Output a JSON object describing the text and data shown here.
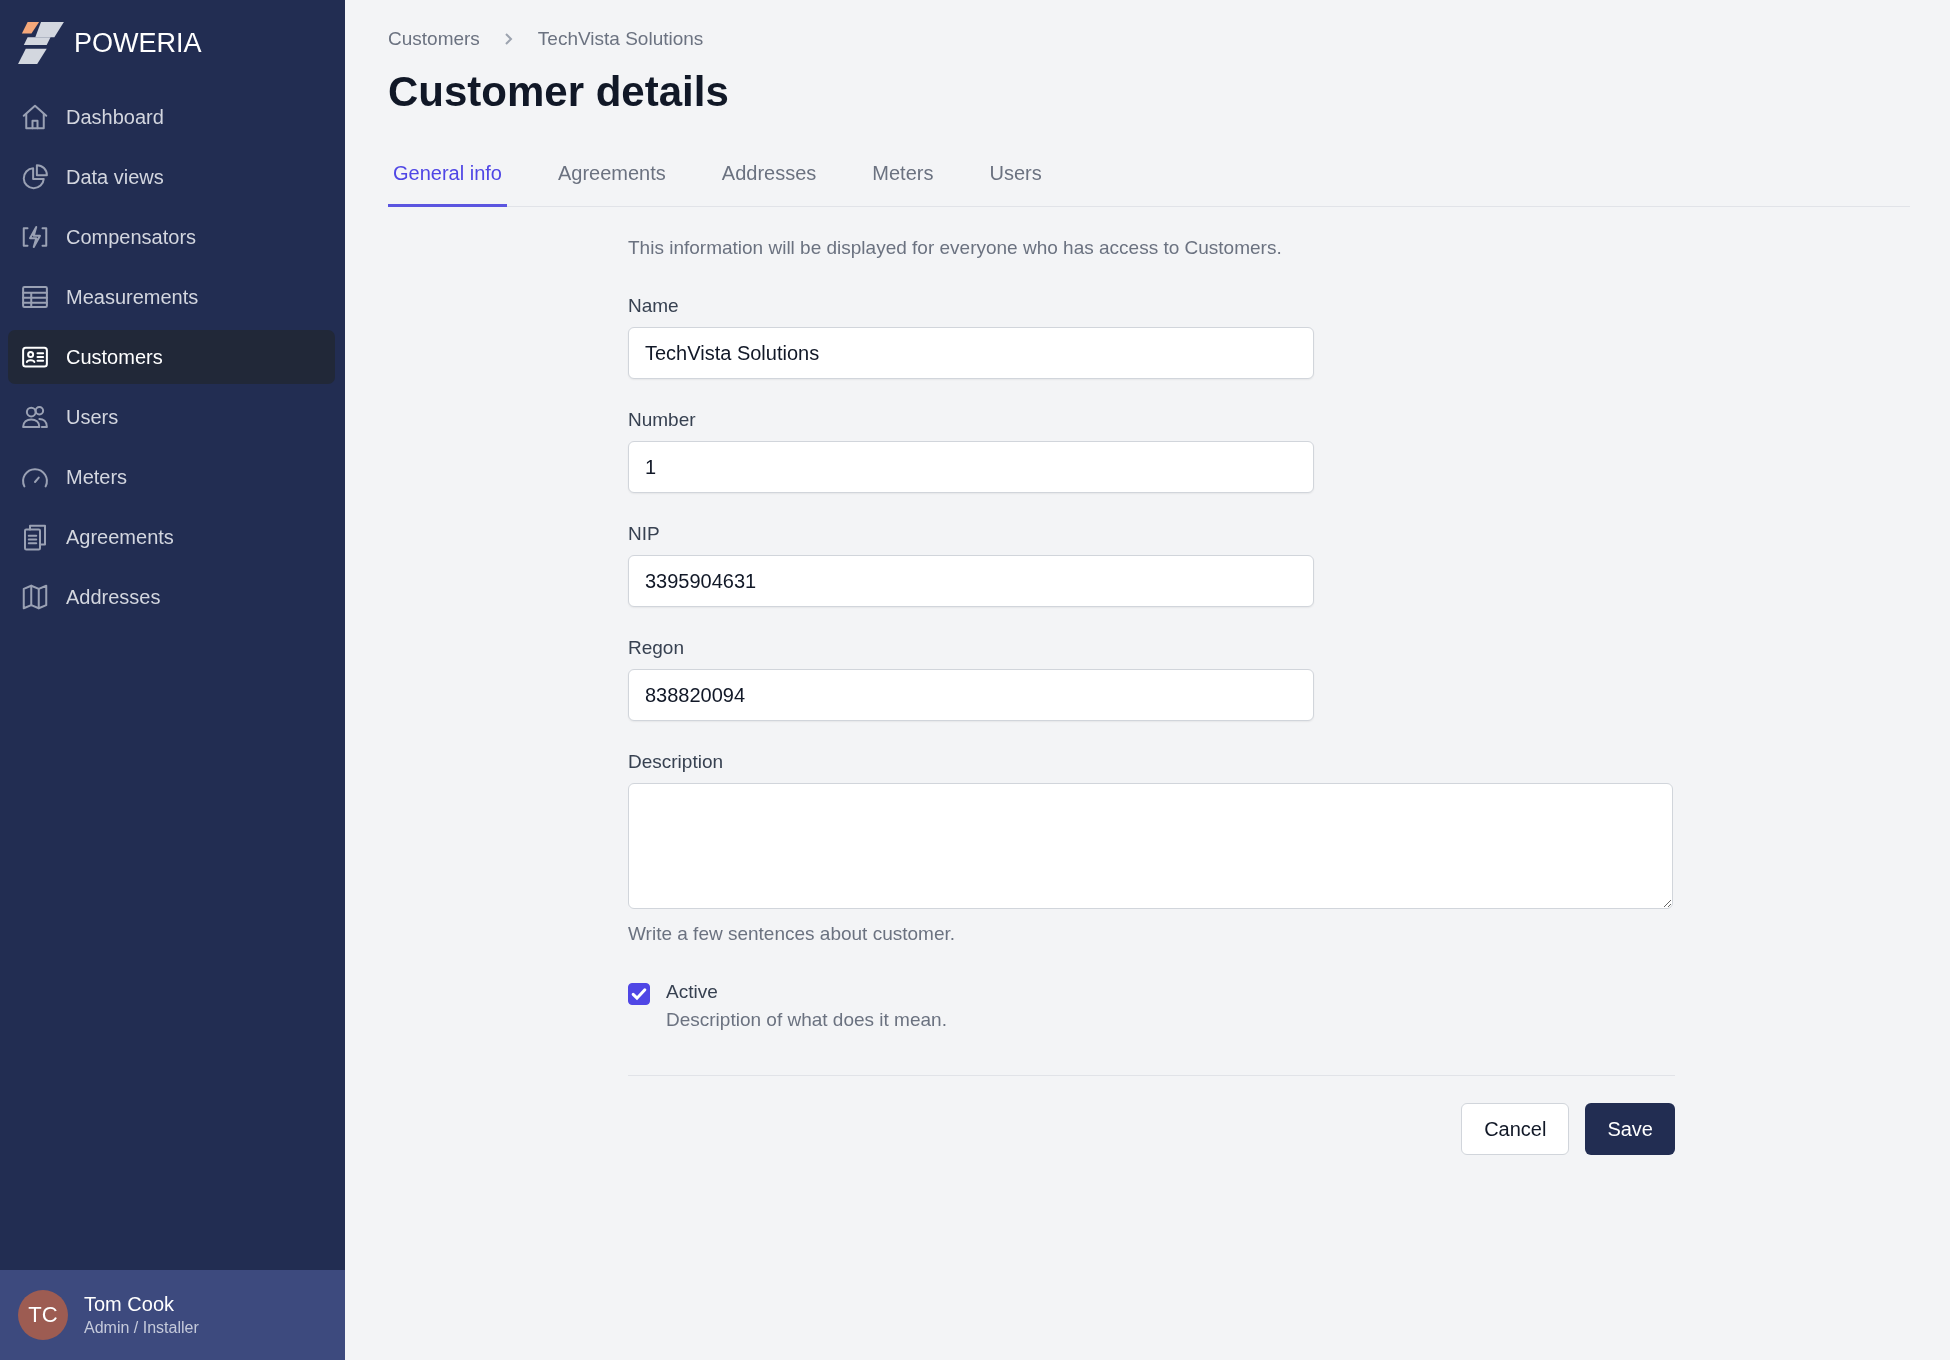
{
  "sidebar": {
    "brand": "POWERIA",
    "items": [
      {
        "label": "Dashboard",
        "selected": false
      },
      {
        "label": "Data views",
        "selected": false
      },
      {
        "label": "Compensators",
        "selected": false
      },
      {
        "label": "Measurements",
        "selected": false
      },
      {
        "label": "Customers",
        "selected": true
      },
      {
        "label": "Users",
        "selected": false
      },
      {
        "label": "Meters",
        "selected": false
      },
      {
        "label": "Agreements",
        "selected": false
      },
      {
        "label": "Addresses",
        "selected": false
      }
    ],
    "user": {
      "initials": "TC",
      "name": "Tom Cook",
      "role": "Admin / Installer"
    }
  },
  "breadcrumb": [
    "Customers",
    "TechVista Solutions"
  ],
  "title": "Customer details",
  "tabs": [
    {
      "label": "General info",
      "selected": true
    },
    {
      "label": "Agreements",
      "selected": false
    },
    {
      "label": "Addresses",
      "selected": false
    },
    {
      "label": "Meters",
      "selected": false
    },
    {
      "label": "Users",
      "selected": false
    }
  ],
  "form": {
    "intro": "This information will be displayed for everyone who has access to Customers.",
    "fields": [
      {
        "kind": "input",
        "label": "Name",
        "value": "TechVista Solutions"
      },
      {
        "kind": "input",
        "label": "Number",
        "value": "1"
      },
      {
        "kind": "input",
        "label": "NIP",
        "value": "3395904631"
      },
      {
        "kind": "input",
        "label": "Regon",
        "value": "838820094"
      },
      {
        "kind": "textarea",
        "label": "Description",
        "hint": "Write a few sentences about customer."
      }
    ],
    "checkbox": {
      "label": "Active",
      "description": "Description of what does it mean.",
      "checked": true
    },
    "buttons": [
      {
        "kind": "secondary",
        "label": "Cancel"
      },
      {
        "kind": "primary",
        "label": "Save"
      }
    ]
  }
}
